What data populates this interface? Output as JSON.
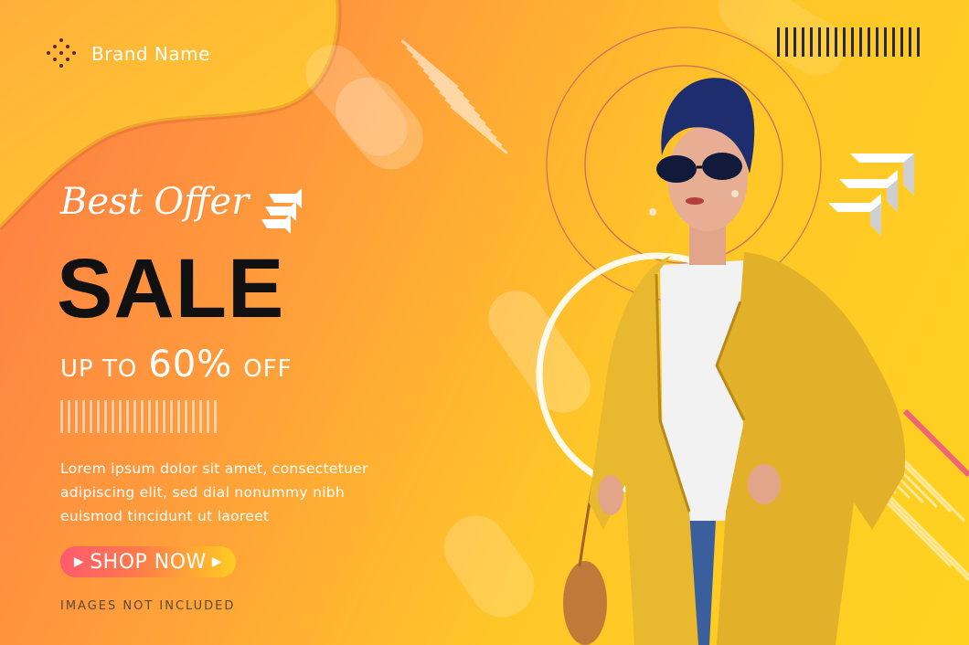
{
  "brand": {
    "name": "Brand Name",
    "logo_icon": "dotted-diamond-icon"
  },
  "headline": {
    "script": "Best Offer",
    "main": "SALE",
    "discount_prefix": "UP TO",
    "discount_value": "60%",
    "discount_suffix": "OFF"
  },
  "description": {
    "line1": "Lorem ipsum dolor sit amet, consectetuer",
    "line2": "adipiscing elit, sed dial nonummy nibh",
    "line3": "euismod tincidunt ut laoreet"
  },
  "cta": {
    "label": "SHOP NOW",
    "left_icon": "play-triangle-icon",
    "right_icon": "play-triangle-icon"
  },
  "footer_note": "IMAGES NOT INCLUDED",
  "colors": {
    "gradient_start": "#ff7a45",
    "gradient_end": "#ffd21f",
    "sale_text": "#111111",
    "coat": "#e8b92e",
    "turban": "#1e2d6e",
    "button_start": "#ff5a6e",
    "button_end": "#ffcc22"
  },
  "icons": [
    "dotted-diamond-icon",
    "chevron-stack-icon",
    "barcode-stripes-icon",
    "play-triangle-icon"
  ]
}
